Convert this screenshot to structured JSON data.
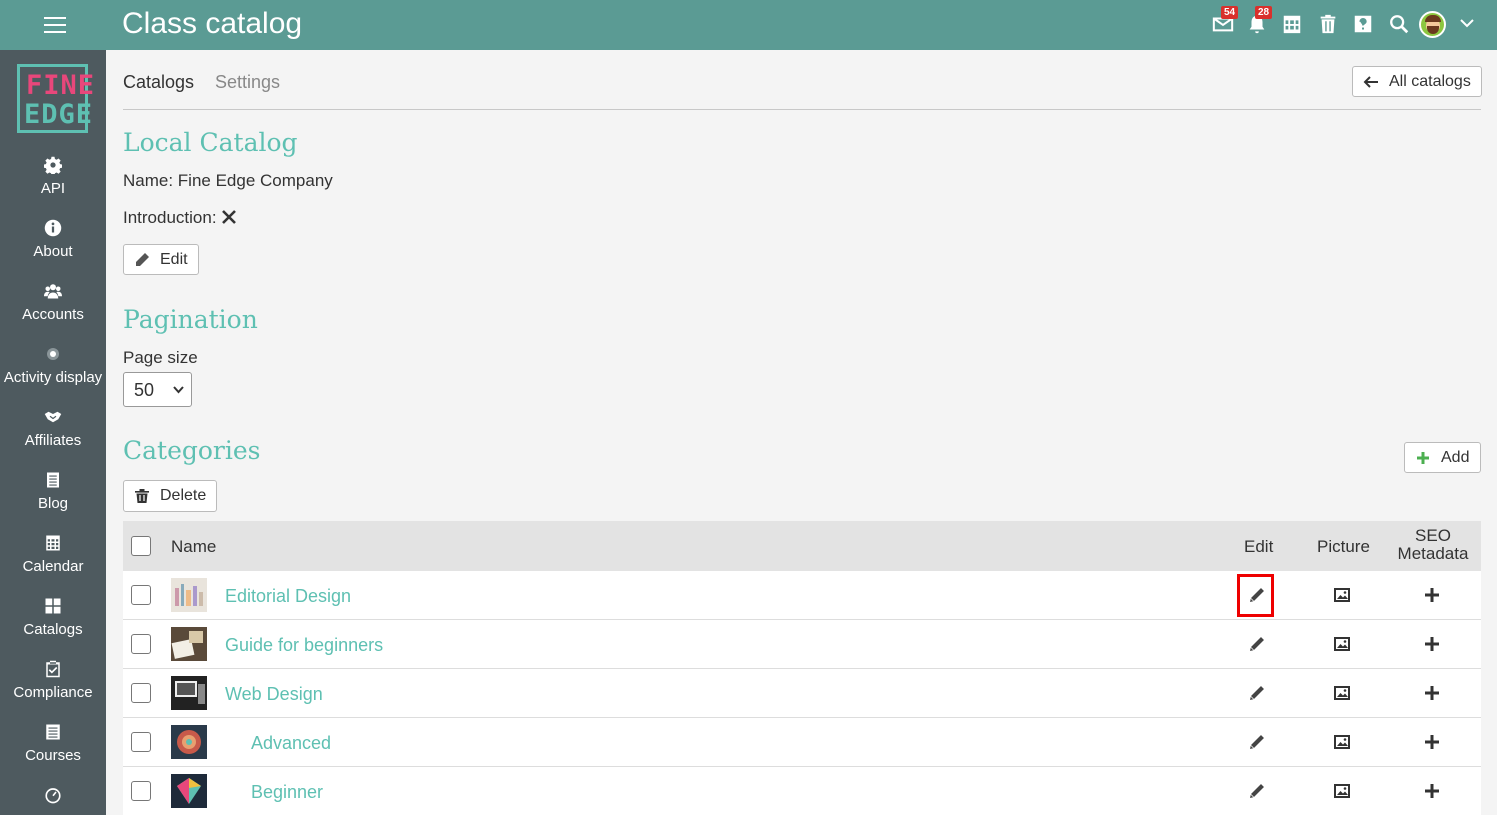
{
  "header": {
    "title": "Class catalog",
    "messages_badge": "54",
    "notifications_badge": "28"
  },
  "sidebar": {
    "logo_line1": "FINE",
    "logo_line2": "EDGE",
    "items": [
      {
        "label": "API",
        "icon": "gear-icon"
      },
      {
        "label": "About",
        "icon": "info-icon"
      },
      {
        "label": "Accounts",
        "icon": "users-icon"
      },
      {
        "label": "Activity display",
        "icon": "radio-icon"
      },
      {
        "label": "Affiliates",
        "icon": "handshake-icon"
      },
      {
        "label": "Blog",
        "icon": "blog-icon"
      },
      {
        "label": "Calendar",
        "icon": "calendar-icon"
      },
      {
        "label": "Catalogs",
        "icon": "grid-icon"
      },
      {
        "label": "Compliance",
        "icon": "clipboard-check-icon"
      },
      {
        "label": "Courses",
        "icon": "courses-icon"
      }
    ]
  },
  "tabs": [
    {
      "label": "Catalogs"
    },
    {
      "label": "Settings"
    }
  ],
  "all_catalogs_label": "All catalogs",
  "local_catalog": {
    "heading": "Local Catalog",
    "name_line": "Name: Fine Edge Company",
    "intro_label": "Introduction:",
    "edit_label": "Edit"
  },
  "pagination": {
    "heading": "Pagination",
    "page_size_label": "Page size",
    "page_size_value": "50"
  },
  "categories": {
    "heading": "Categories",
    "add_label": "Add",
    "delete_label": "Delete",
    "columns": {
      "name": "Name",
      "edit": "Edit",
      "picture": "Picture",
      "seo_line1": "SEO",
      "seo_line2": "Metadata"
    },
    "rows": [
      {
        "name": "Editorial Design",
        "indent": 0
      },
      {
        "name": "Guide for beginners",
        "indent": 0
      },
      {
        "name": "Web Design",
        "indent": 0
      },
      {
        "name": "Advanced",
        "indent": 1
      },
      {
        "name": "Beginner",
        "indent": 1
      }
    ]
  },
  "colors": {
    "topbar": "#5b9b94",
    "sidebar": "#4e5a5f",
    "accent": "#5ec0b2",
    "badge": "#d9302c",
    "highlight": "#e00000"
  }
}
